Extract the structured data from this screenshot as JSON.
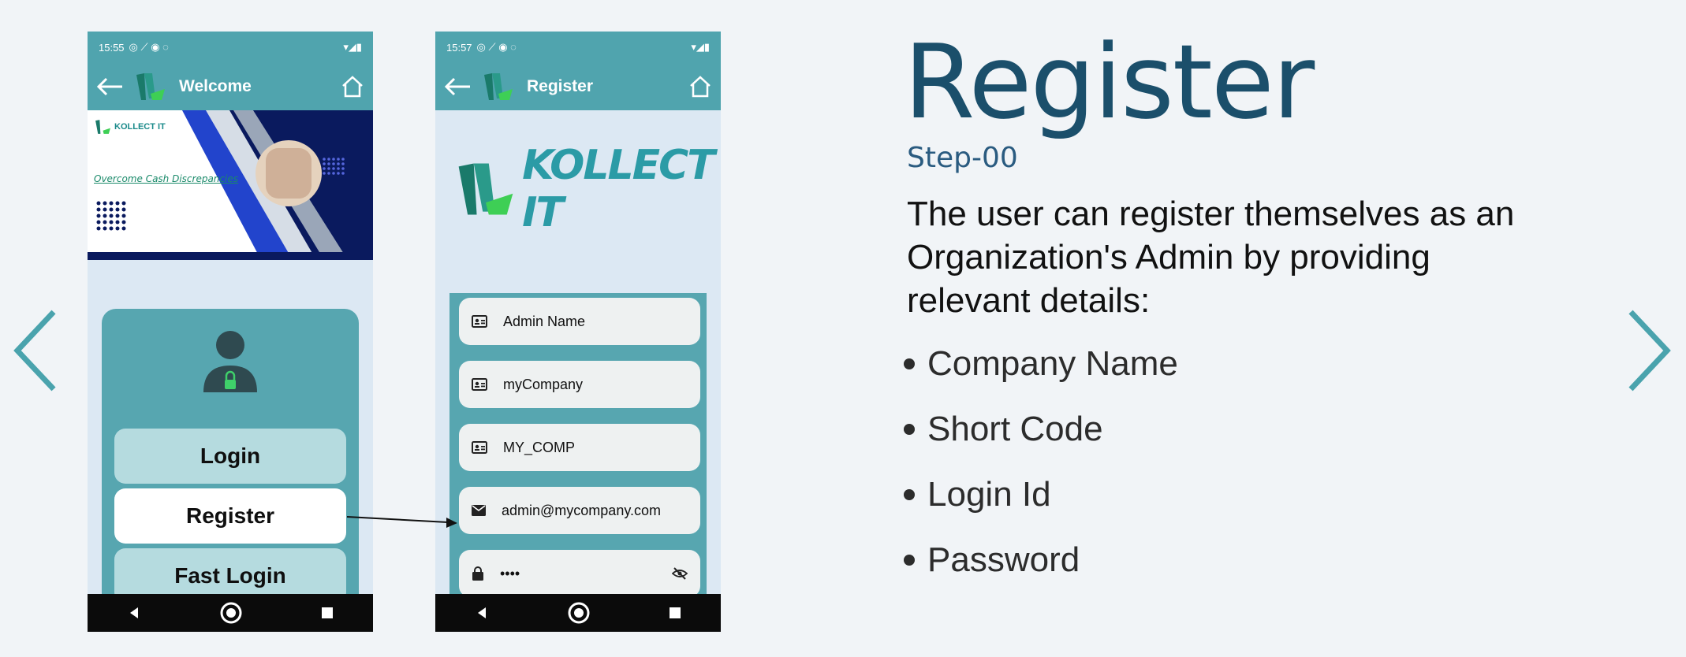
{
  "slide": {
    "title": "Register",
    "step": "Step-00",
    "description": "The user can register themselves as an Organization's Admin by providing relevant details:",
    "bullets": [
      "Company Name",
      "Short Code",
      "Login Id",
      "Password"
    ]
  },
  "phone1": {
    "time": "15:55",
    "title": "Welcome",
    "banner_logo": "KOLLECT IT",
    "banner_tagline": "Overcome Cash Discrepancies",
    "buttons": {
      "login": "Login",
      "register": "Register",
      "fast_login": "Fast Login"
    }
  },
  "phone2": {
    "time": "15:57",
    "title": "Register",
    "logo": "KOLLECT IT",
    "fields": {
      "admin_name": "Admin Name",
      "company": "myCompany",
      "short_code": "MY_COMP",
      "email": "admin@mycompany.com",
      "password": "••••"
    }
  },
  "colors": {
    "teal": "#50a4ae",
    "title_blue": "#1b4f6b",
    "chevron": "#4aa3ad"
  },
  "icons": [
    "back-arrow-icon",
    "home-icon",
    "user-lock-icon",
    "id-card-icon",
    "mail-icon",
    "lock-icon",
    "eye-off-icon",
    "chevron-left-icon",
    "chevron-right-icon"
  ]
}
